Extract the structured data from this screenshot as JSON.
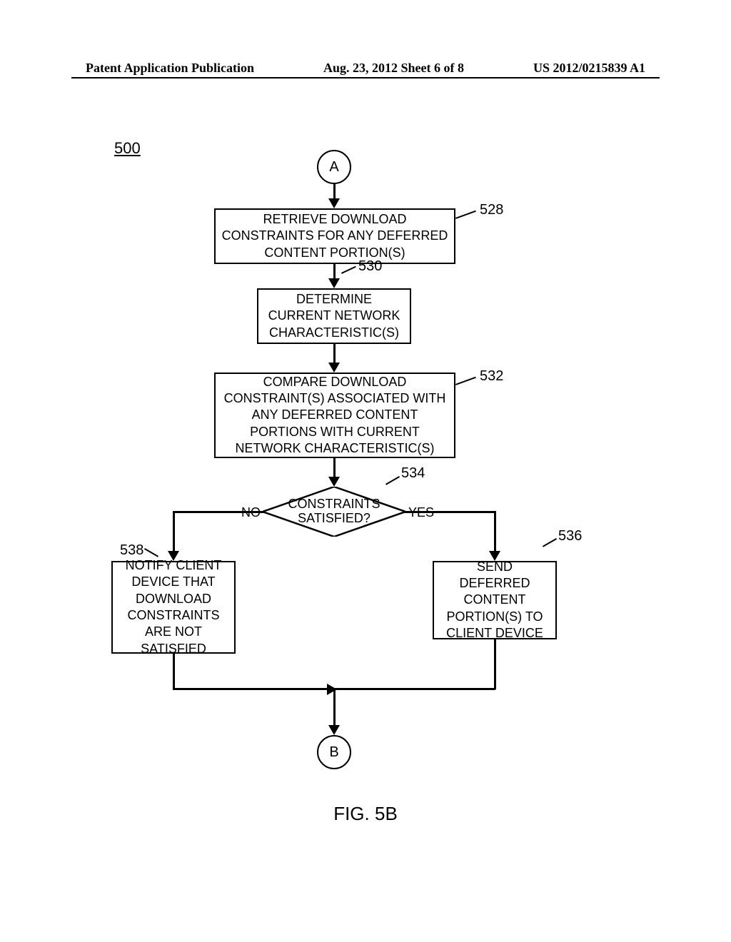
{
  "header": {
    "left": "Patent Application Publication",
    "center": "Aug. 23, 2012  Sheet 6 of 8",
    "right": "US 2012/0215839 A1"
  },
  "figure_number": "500",
  "connectors": {
    "a": "A",
    "b": "B"
  },
  "boxes": {
    "box528": "RETRIEVE DOWNLOAD CONSTRAINTS FOR ANY DEFERRED CONTENT PORTION(S)",
    "box530": "DETERMINE CURRENT NETWORK CHARACTERISTIC(S)",
    "box532": "COMPARE DOWNLOAD CONSTRAINT(S) ASSOCIATED WITH ANY DEFERRED CONTENT PORTIONS WITH CURRENT NETWORK CHARACTERISTIC(S)",
    "box536": "SEND DEFERRED CONTENT PORTION(S) TO CLIENT DEVICE",
    "box538": "NOTIFY CLIENT DEVICE THAT DOWNLOAD CONSTRAINTS ARE NOT SATISFIED"
  },
  "decision": {
    "text": "CONSTRAINTS SATISFIED?"
  },
  "branches": {
    "no": "NO",
    "yes": "YES"
  },
  "refs": {
    "r528": "528",
    "r530": "530",
    "r532": "532",
    "r534": "534",
    "r536": "536",
    "r538": "538"
  },
  "caption": "FIG. 5B"
}
